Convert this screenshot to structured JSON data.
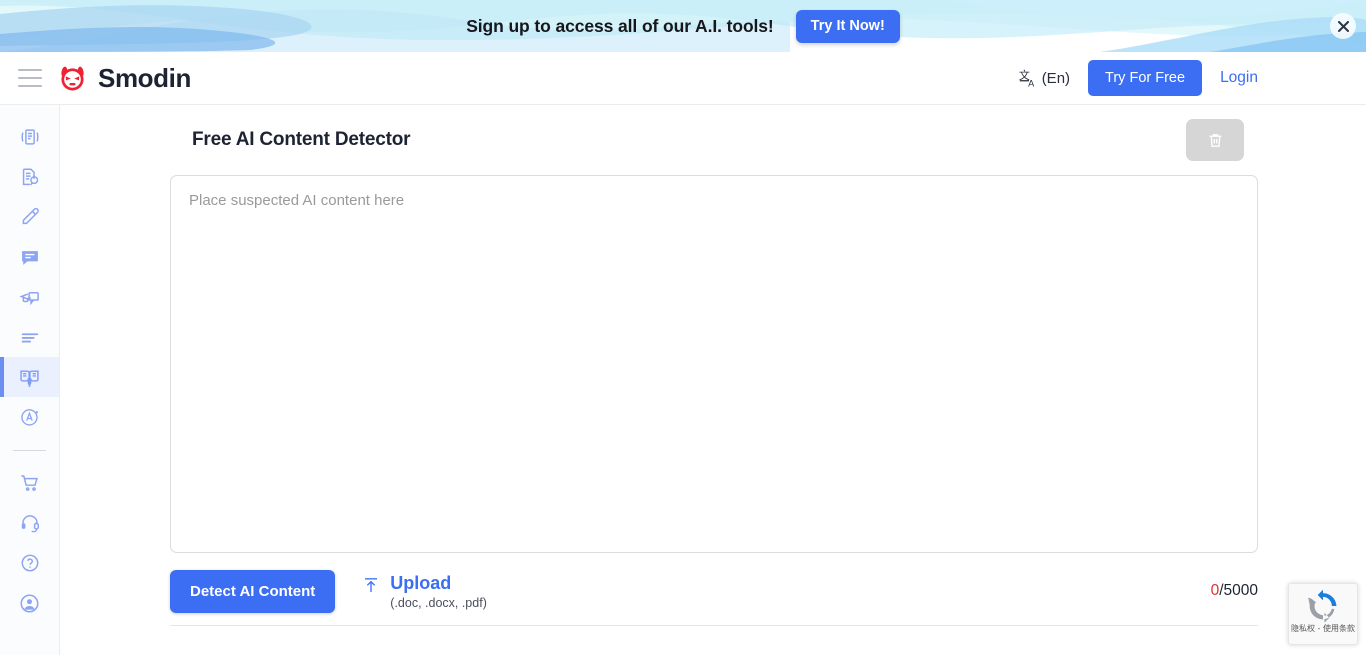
{
  "promo": {
    "text": "Sign up to access all of our A.I. tools!",
    "cta_label": "Try It Now!",
    "close_icon": "close-icon",
    "accent_color": "#3b6ef3"
  },
  "nav": {
    "menu_icon": "hamburger-icon",
    "logo_icon": "smodin-robot-logo-icon",
    "brand": "Smodin",
    "language": {
      "icon": "translate-icon",
      "label": "(En)"
    },
    "try_free_label": "Try For Free",
    "login_label": "Login",
    "brand_color": "#e8192c",
    "accent_color": "#3b6ef3"
  },
  "sidebar": {
    "items": [
      {
        "name": "sidebar-item-rewriter",
        "icon": "document-quotes-icon",
        "active": false
      },
      {
        "name": "sidebar-item-plagiarism-checker",
        "icon": "document-search-icon",
        "active": false
      },
      {
        "name": "sidebar-item-writer",
        "icon": "pencil-icon",
        "active": false
      },
      {
        "name": "sidebar-item-chat",
        "icon": "chat-bubble-icon",
        "active": false
      },
      {
        "name": "sidebar-item-homework-helper",
        "icon": "graduation-chat-icon",
        "active": false
      },
      {
        "name": "sidebar-item-summarizer",
        "icon": "text-lines-icon",
        "active": false
      },
      {
        "name": "sidebar-item-ai-content-detector",
        "icon": "open-book-bulb-icon",
        "active": true
      },
      {
        "name": "sidebar-item-grader",
        "icon": "grade-a-icon",
        "active": false
      }
    ],
    "bottom_items": [
      {
        "name": "sidebar-item-store",
        "icon": "shopping-cart-icon",
        "active": false
      },
      {
        "name": "sidebar-item-support",
        "icon": "headset-icon",
        "active": false
      },
      {
        "name": "sidebar-item-help",
        "icon": "question-circle-icon",
        "active": false
      },
      {
        "name": "sidebar-item-account",
        "icon": "user-circle-icon",
        "active": false
      }
    ],
    "active_bg": "#eaf0fe",
    "icon_color": "#8da4f2"
  },
  "tool": {
    "title": "Free AI Content Detector",
    "clear_icon": "trash-icon",
    "textarea": {
      "placeholder": "Place suspected AI content here",
      "value": ""
    },
    "detect_label": "Detect AI Content",
    "upload": {
      "icon": "upload-arrow-icon",
      "label": "Upload",
      "formats": "(.doc, .docx, .pdf)"
    },
    "counter": {
      "used": "0",
      "limit": "/5000",
      "used_color": "#e03131"
    }
  },
  "recaptcha": {
    "icon": "recaptcha-icon",
    "legal": "隐私权 - 使用条款"
  }
}
